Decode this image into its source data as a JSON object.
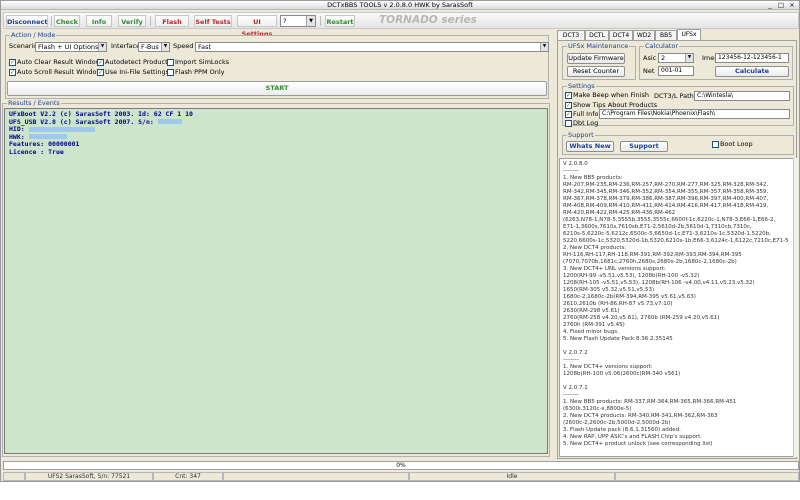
{
  "window": {
    "title": "DCTxBBS TOOLS v 2.0.8.0 HWK by SarasSoft",
    "minimize": "_",
    "maximize": "□",
    "close": "×"
  },
  "toolbar": {
    "disconnect": "Disconnect",
    "check": "Check",
    "info": "Info",
    "verify": "Verify",
    "flash": "Flash",
    "self_tests": "Self Tests",
    "ui_settings": "UI Settings",
    "ui_select": "?",
    "restart": "Restart",
    "brand": "TORNADO  series",
    "colors": {
      "disconnect": "#1c3f94",
      "green": "#2e8b2e",
      "red": "#c0242a"
    }
  },
  "action_mode": {
    "label": "Action / Mode",
    "scenario_label": "Scenario",
    "scenario_value": "Flash + UI Options",
    "interface_label": "Interface",
    "interface_value": "F-Bus",
    "speed_label": "Speed",
    "speed_value": "Fast",
    "checkboxes": [
      {
        "label": "Auto Clear Result Window",
        "checked": true
      },
      {
        "label": "Autodetect Product",
        "checked": true
      },
      {
        "label": "Import SimLocks",
        "checked": false
      },
      {
        "label": "Auto Scroll Result Window",
        "checked": true
      },
      {
        "label": "Use Ini-File Settings",
        "checked": true
      },
      {
        "label": "Flash PPM Only",
        "checked": false
      }
    ],
    "start": "START"
  },
  "results": {
    "label": "Results / Events",
    "lines": [
      "UFxBoot V2.2 (c) SarasSoft 2003. Id: 62 CF 1 10",
      "UFS_USB V2.8 (c) SarasSoft 2007. S/n:",
      "HID:",
      "HWK:",
      "Features: 00000001",
      "Licence : True"
    ]
  },
  "tabs": [
    "DCT3",
    "DCTL",
    "DCT4",
    "WD2",
    "BB5",
    "UFSx"
  ],
  "active_tab": "UFSx",
  "ufsx": {
    "maintenance_label": "UFSx Maintenance",
    "update_firmware": "Update Firmware",
    "reset_counter": "Reset Counter",
    "calculator_label": "Calculator",
    "asic_label": "Asic",
    "asic_value": "2",
    "imei_label": "Imei",
    "imei_value": "123456-12-123456-1",
    "net_label": "Net",
    "net_value": "001-01",
    "calculate": "Calculate",
    "settings_label": "Settings",
    "make_beep": "Make Beep when Finish",
    "show_tips": "Show Tips About Products",
    "full_info": "Full Info",
    "dbg_log": "Dbt Log",
    "dct3l_path_label": "DCT3/L Path",
    "dct3l_path": "C:\\Wintesla\\",
    "full_info_path": "C:\\Program Files\\Nokia\\Phoenix\\Flash\\",
    "support_label": "Support",
    "whats_new": "Whats New",
    "support": "Support",
    "boot_loop": "Boot Loop"
  },
  "info_lines": [
    "V 2.0.8.0",
    "--------",
    "1. New BB5 products:",
    " RM-207,RM-235,RM-236,RM-257,RM-270,RM-277,RM-325,RM-328,RM-342,",
    " RM-342,RM-345,RM-346,RM-352,RM-354,RM-355,RM-357,RM-358,RM-359,",
    " RM-367,RM-378,RM-379,RM-386,RM-387,RM-396,RM-397,RM-400,RM-407,",
    " RM-408,RM-409,RM-410,RM-411,RM-414,RM-416,RM-417,RM-418,RM-419,",
    " RM-420,RM-422,RM-425,RM-436,RM-462",
    " (6263,N78-1,N78-5,3555b,3555,3555c,6600f-1c,6220c-1,N78-3,E66-1,E66-2,",
    " E71-1,3600s,7610s,7610sb,E71-2,5610d-2b,5610d-1,7310cb,7310c,",
    " 6210s-5,6220c-5,6212c,6500c-5,6650d-1c,E71-3,6210s-1c,5320d-1,5220b,",
    " 5220,6600s-1c,5320,5320d-1b,5320,6210s-1b,E66-3,6124c-1,6122c,7210c,E71-5",
    "2. New DCT4 products:",
    " RH-116,RH-117,RH-118,RM-391,RM-392,RM-393,RM-394,RM-395",
    " (7070,7070b,1681c,2760h,2680s,2680s-2b,1680c-2,1680c-2b)",
    "3. New DCT4+ UNL versions support:",
    " 1200(RH-99 -v5.51,v5.53), 1208b(RH-100 -v5.32)",
    " 1208(RH-105 -v5.51,v5.53), 1208b(RH-106 -v4.00,v4.11,v5.23,v5.32)",
    " 1650(RM-305 v5.32,v5.51,v5.53)",
    " 1680c-2,1680c-2b(RM-394,RM-395 v5.61,v5.63)",
    " 2610,2610b (RH-86,RH-87 v5.73,v7.10)",
    " 2630(RM-298 v5.61)",
    " 2760(RM-258 v4.20,v5.61), 2760b (RM-259 v4.20,v5.61)",
    " 2760h (RM-391 v5.45)",
    "4. Fixed minor bugs.",
    "5. New Flash Update Pack 8.36.2.35145",
    "",
    "V 2.0.7.2",
    "--------",
    "1. New DCT4+ versions support:",
    " 1208b(RH-100 v5.06)2600c(RM-340 v561)",
    "",
    "V 2.0.7.1",
    "--------",
    "1. New BB5 products: RM-337,RM-364,RM-365,RM-366,RM-451",
    " (6300i,3120c-x,8800e-5)",
    "2. New DCT4 products: RM-340,RM-341,RM-362,RM-363",
    " (2600c-2,2600c-2b,5000d-2,5000d-2b)",
    "3. Flash Update pack (8.6.1.31560) added.",
    "4. New RAP, UPP ASIC's and FLASH Chip's support.",
    "5. New DCT4+ product unlock (see corresponding list)"
  ],
  "progress": {
    "text": "0%",
    "fraction": 0.0
  },
  "status": {
    "left": "",
    "serial": "UFS2 SarasSoft, S/n: 77521",
    "count": "Cnt: 347",
    "middle": "",
    "state": "Idle",
    "right": ""
  }
}
